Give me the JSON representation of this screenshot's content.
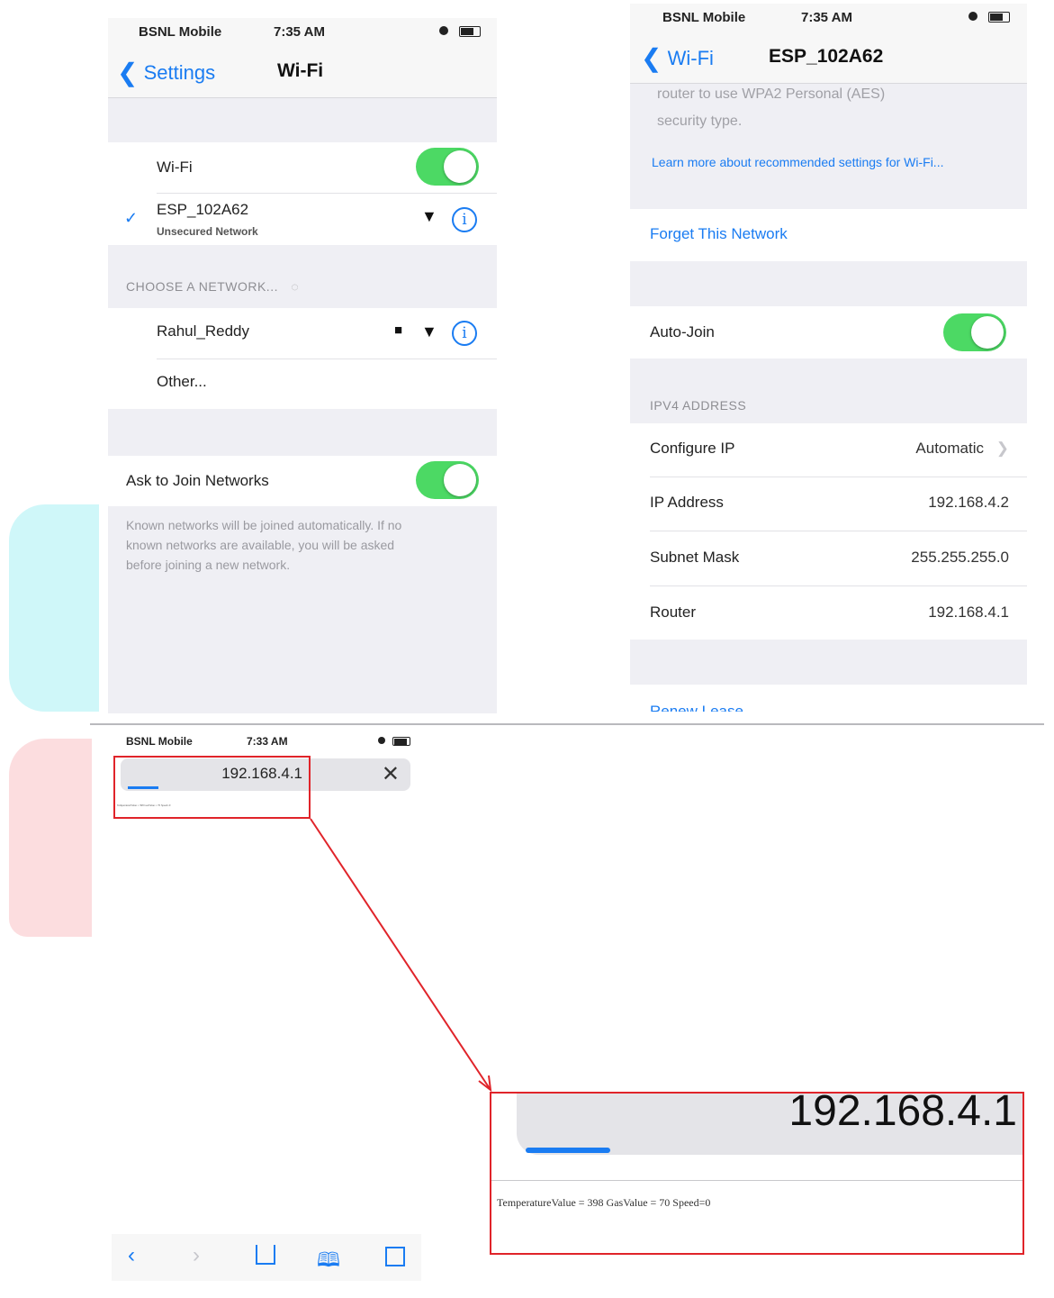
{
  "status": {
    "carrier": "BSNL Mobile",
    "time_a": "7:35 AM",
    "time_b": "7:35 AM",
    "time_c": "7:33 AM"
  },
  "wifi_settings": {
    "back_label": "Settings",
    "title": "Wi-Fi",
    "wifi_label": "Wi-Fi",
    "connected_network": "ESP_102A62",
    "connected_sub": "Unsecured Network",
    "choose_header": "CHOOSE A NETWORK...",
    "networks": [
      "Rahul_Reddy",
      "Other..."
    ],
    "ask_to_join": "Ask to Join Networks",
    "ask_footer_lines": [
      "Known networks will be joined automatically. If no",
      "known networks are available, you will be asked",
      "before joining a new network."
    ]
  },
  "network_detail": {
    "back_label": "Wi-Fi",
    "title": "ESP_102A62",
    "security_lines": [
      "router to use WPA2 Personal (AES)",
      "security type."
    ],
    "learn_more": "Learn more about recommended settings for Wi-Fi...",
    "forget": "Forget This Network",
    "auto_join": "Auto-Join",
    "ipv4_header": "IPV4 ADDRESS",
    "rows": [
      {
        "label": "Configure IP",
        "value": "Automatic"
      },
      {
        "label": "IP Address",
        "value": "192.168.4.2"
      },
      {
        "label": "Subnet Mask",
        "value": "255.255.255.0"
      },
      {
        "label": "Router",
        "value": "192.168.4.1"
      }
    ],
    "renew": "Renew Lease"
  },
  "browser": {
    "url": "192.168.4.1",
    "page_text_small": "TemperatureValue = 398 GasValue = 70 Speed=0",
    "zoom_url": "192.168.4.1",
    "zoom_text": "TemperatureValue = 398 GasValue = 70 Speed=0"
  },
  "colors": {
    "accent": "#1a7cf2",
    "toggle_on": "#4cd964",
    "annotation": "#e0242a"
  }
}
